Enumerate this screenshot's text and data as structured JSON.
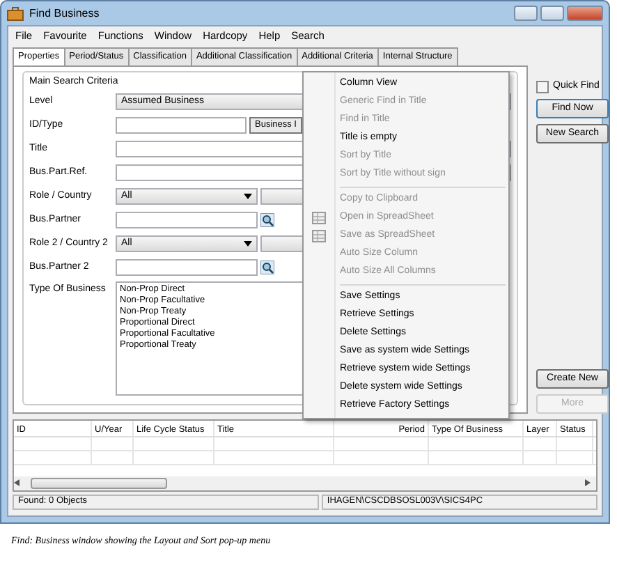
{
  "window": {
    "title": "Find Business"
  },
  "menu_bar": [
    "File",
    "Favourite",
    "Functions",
    "Window",
    "Hardcopy",
    "Help",
    "Search"
  ],
  "tabs": [
    {
      "label": "Properties",
      "selected": true
    },
    {
      "label": "Period/Status",
      "selected": false
    },
    {
      "label": "Classification",
      "selected": false
    },
    {
      "label": "Additional Classification",
      "selected": false
    },
    {
      "label": "Additional Criteria",
      "selected": false
    },
    {
      "label": "Internal Structure",
      "selected": false
    }
  ],
  "group_title": "Main Search Criteria",
  "fields": [
    {
      "label": "Level",
      "kind": "select",
      "value": "Assumed Business"
    },
    {
      "label": "ID/Type",
      "kind": "textbutton",
      "button": "Business I"
    },
    {
      "label": "Title",
      "kind": "text"
    },
    {
      "label": "Bus.Part.Ref.",
      "kind": "text"
    },
    {
      "label": "Role / Country",
      "kind": "select2",
      "value": "All"
    },
    {
      "label": "Bus.Partner",
      "kind": "lookup"
    },
    {
      "label": "Role 2 / Country 2",
      "kind": "select2",
      "value": "All"
    },
    {
      "label": "Bus.Partner 2",
      "kind": "lookup"
    },
    {
      "label": "Type Of Business",
      "kind": "list",
      "options": [
        "Non-Prop Direct",
        "Non-Prop Facultative",
        "Non-Prop Treaty",
        "Proportional Direct",
        "Proportional Facultative",
        "Proportional Treaty"
      ]
    }
  ],
  "quick_find": {
    "label": "Quick Find",
    "checked": false
  },
  "top_buttons": [
    {
      "label": "Find Now",
      "disabled": false
    },
    {
      "label": "New Search",
      "disabled": false
    }
  ],
  "bottom_buttons": [
    {
      "label": "Create New",
      "disabled": false
    },
    {
      "label": "More",
      "disabled": true
    }
  ],
  "context_menu": [
    {
      "kind": "item",
      "label": "Column View",
      "disabled": false
    },
    {
      "kind": "item",
      "label": "Generic Find in Title",
      "disabled": true
    },
    {
      "kind": "item",
      "label": "Find in Title",
      "disabled": true
    },
    {
      "kind": "item",
      "label": "Title is empty",
      "disabled": false
    },
    {
      "kind": "item",
      "label": "Sort by Title",
      "disabled": true
    },
    {
      "kind": "item",
      "label": "Sort by Title without sign",
      "disabled": true
    },
    {
      "kind": "separator"
    },
    {
      "kind": "item",
      "label": "Copy to Clipboard",
      "disabled": true
    },
    {
      "kind": "icon_item",
      "label": "Open in SpreadSheet",
      "disabled": true
    },
    {
      "kind": "icon_item",
      "label": "Save as SpreadSheet",
      "disabled": true
    },
    {
      "kind": "item",
      "label": "Auto Size Column",
      "disabled": true
    },
    {
      "kind": "item",
      "label": "Auto Size All Columns",
      "disabled": true
    },
    {
      "kind": "separator"
    },
    {
      "kind": "item",
      "label": "Save Settings",
      "disabled": false
    },
    {
      "kind": "item",
      "label": "Retrieve Settings",
      "disabled": false
    },
    {
      "kind": "item",
      "label": "Delete Settings",
      "disabled": false
    },
    {
      "kind": "item",
      "label": "Save as system wide Settings",
      "disabled": false
    },
    {
      "kind": "item",
      "label": "Retrieve system wide Settings",
      "disabled": false
    },
    {
      "kind": "item",
      "label": "Delete system wide Settings",
      "disabled": false
    },
    {
      "kind": "item",
      "label": "Retrieve Factory Settings",
      "disabled": false
    }
  ],
  "table": {
    "columns": [
      "ID",
      "U/Year",
      "Life Cycle Status",
      "Title",
      "Period",
      "Type Of Business",
      "Layer",
      "Status"
    ]
  },
  "status_bar": [
    "Found: 0 Objects",
    "IHAGEN\\CSCDBSOSL003V\\SICS4PC"
  ],
  "caption": "Find: Business window showing the Layout and Sort pop-up menu"
}
